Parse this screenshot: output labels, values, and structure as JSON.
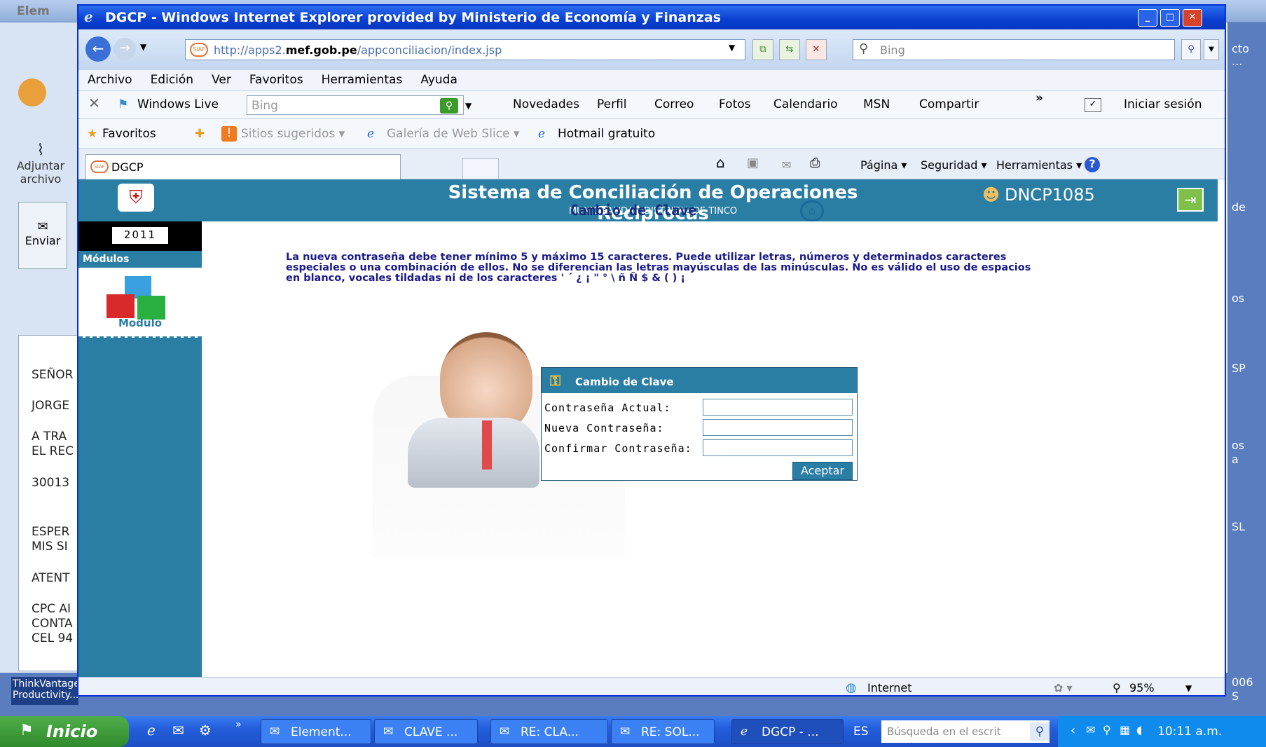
{
  "bg_window": {
    "title": "Elem",
    "attach_label": "Adjuntar archivo",
    "send_label": "Enviar",
    "doc_lines": [
      "SEÑOR",
      "JORGE",
      "A TRA",
      "EL REC",
      "30013",
      "ESPER",
      "MIS SI",
      "ATENT",
      "CPC AI",
      "CONTA",
      "CEL 94"
    ],
    "right_texts": [
      "cto",
      "...",
      "de",
      "os",
      "SP",
      "os",
      "a",
      "SL",
      "006",
      "S"
    ],
    "thinkvantage": "ThinkVantage Productivity..."
  },
  "browser": {
    "title": "DGCP - Windows Internet Explorer provided by Ministerio de Economía y Finanzas",
    "url_prefix": "http://apps2.",
    "url_domain": "mef.gob.pe",
    "url_path": "/appconciliacion/index.jsp",
    "search_placeholder": "Bing",
    "menu": [
      "Archivo",
      "Edición",
      "Ver",
      "Favoritos",
      "Herramientas",
      "Ayuda"
    ],
    "toolbar": {
      "windows_live": "Windows Live",
      "bing_placeholder": "Bing",
      "links": [
        "Novedades",
        "Perfil",
        "Correo",
        "Fotos",
        "Calendario",
        "MSN",
        "Compartir"
      ],
      "more": "»",
      "signin": "Iniciar sesión"
    },
    "favbar": {
      "favoritos": "Favoritos",
      "sitios": "Sitios sugeridos ▾",
      "galeria": "Galería de Web Slice ▾",
      "hotmail": "Hotmail gratuito"
    },
    "tab_label": "DGCP",
    "commands": [
      "Página ▾",
      "Seguridad ▾",
      "Herramientas ▾"
    ],
    "status_zone": "Internet",
    "zoom": "95%"
  },
  "app": {
    "title": "Sistema de Conciliación de Operaciones Reciprocas",
    "subtitle": "MUNICIPALIDAD DISTRITAL DE TINCO",
    "user": "DNCP1085",
    "year": "2011",
    "modules_label": "Módulos",
    "module_label": "Modulo",
    "page_title": "Cambio de Clave",
    "notice": "La nueva contraseña debe tener mínimo 5 y máximo 15 caracteres. Puede utilizar letras, números y determinados caracteres especiales o una combinación de ellos. No se diferencian las letras mayúsculas de las minúsculas. No es válido el uso de espacios en blanco, vocales tildadas ni de los caracteres ' ´ ¿ ¡ \" ° \\ ñ Ñ $ & ( ) ¡",
    "dialog": {
      "title": "Cambio de Clave",
      "current_label": "Contraseña Actual:",
      "new_label": "Nueva Contraseña:",
      "confirm_label": "Confirmar Contraseña:",
      "submit": "Aceptar"
    }
  },
  "taskbar": {
    "start": "Inicio",
    "buttons": [
      "Element...",
      "CLAVE ...",
      "RE: CLA...",
      "RE: SOL...",
      "DGCP - ..."
    ],
    "lang": "ES",
    "search_placeholder": "Búsqueda en el escrit",
    "time": "10:11 a.m."
  }
}
